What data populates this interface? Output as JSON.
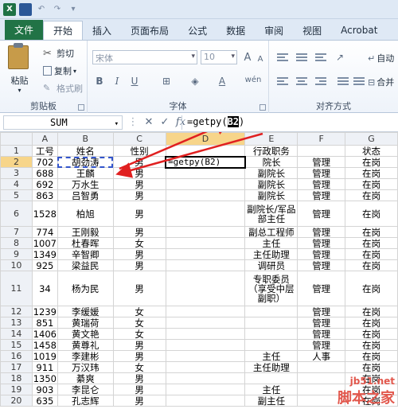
{
  "tabs": [
    "文件",
    "开始",
    "插入",
    "页面布局",
    "公式",
    "数据",
    "审阅",
    "视图",
    "Acrobat"
  ],
  "ribbon": {
    "clipboard": {
      "paste": "粘贴",
      "cut": "剪切",
      "copy": "复制",
      "format_painter": "格式刷",
      "label": "剪贴板"
    },
    "font": {
      "name": "宋体",
      "size": "10",
      "label": "字体",
      "bold": "B",
      "italic": "I",
      "underline": "U",
      "grow": "A",
      "shrink": "A",
      "wen": "wén"
    },
    "alignment": {
      "label": "对齐方式",
      "wrap": "自动",
      "merge": "合并"
    }
  },
  "formula_bar": {
    "name_box": "SUM",
    "cancel": "✕",
    "enter": "✓",
    "fx": "fx",
    "formula_prefix": "=getpy(",
    "formula_ref": "B2",
    "formula_suffix": ")"
  },
  "columns": [
    "A",
    "B",
    "C",
    "D",
    "E",
    "F",
    "G"
  ],
  "rows": [
    {
      "n": "1",
      "a": "工号",
      "b": "姓名",
      "c": "性别",
      "d": "",
      "e": "行政职务",
      "f": "",
      "g": "状态"
    },
    {
      "n": "2",
      "a": "702",
      "b": "胡劲涛",
      "c": "男",
      "d": "=getpy(B2)",
      "e": "院长",
      "f": "管理",
      "g": "在岗"
    },
    {
      "n": "3",
      "a": "688",
      "b": "王麟",
      "c": "男",
      "d": "",
      "e": "副院长",
      "f": "管理",
      "g": "在岗"
    },
    {
      "n": "4",
      "a": "692",
      "b": "万水生",
      "c": "男",
      "d": "",
      "e": "副院长",
      "f": "管理",
      "g": "在岗"
    },
    {
      "n": "5",
      "a": "863",
      "b": "吕智勇",
      "c": "男",
      "d": "",
      "e": "副院长",
      "f": "管理",
      "g": "在岗"
    },
    {
      "n": "6",
      "a": "1528",
      "b": "柏旭",
      "c": "男",
      "d": "",
      "e": "副院长/军品部主任",
      "f": "管理",
      "g": "在岗"
    },
    {
      "n": "7",
      "a": "774",
      "b": "王刚毅",
      "c": "男",
      "d": "",
      "e": "副总工程师",
      "f": "管理",
      "g": "在岗"
    },
    {
      "n": "8",
      "a": "1007",
      "b": "杜春晖",
      "c": "女",
      "d": "",
      "e": "主任",
      "f": "管理",
      "g": "在岗"
    },
    {
      "n": "9",
      "a": "1349",
      "b": "辛智卿",
      "c": "男",
      "d": "",
      "e": "主任助理",
      "f": "管理",
      "g": "在岗"
    },
    {
      "n": "10",
      "a": "925",
      "b": "梁益民",
      "c": "男",
      "d": "",
      "e": "调研员",
      "f": "管理",
      "g": "在岗"
    },
    {
      "n": "11",
      "a": "34",
      "b": "杨为民",
      "c": "男",
      "d": "",
      "e": "专职委员（享受中层副职）",
      "f": "管理",
      "g": "在岗"
    },
    {
      "n": "12",
      "a": "1239",
      "b": "李缓媛",
      "c": "女",
      "d": "",
      "e": "",
      "f": "管理",
      "g": "在岗"
    },
    {
      "n": "13",
      "a": "851",
      "b": "黄瑞荷",
      "c": "女",
      "d": "",
      "e": "",
      "f": "管理",
      "g": "在岗"
    },
    {
      "n": "14",
      "a": "1406",
      "b": "黄文艳",
      "c": "女",
      "d": "",
      "e": "",
      "f": "管理",
      "g": "在岗"
    },
    {
      "n": "15",
      "a": "1458",
      "b": "黄尊礼",
      "c": "男",
      "d": "",
      "e": "",
      "f": "管理",
      "g": "在岗"
    },
    {
      "n": "16",
      "a": "1019",
      "b": "李建彬",
      "c": "男",
      "d": "",
      "e": "主任",
      "f": "人事",
      "g": "在岗"
    },
    {
      "n": "17",
      "a": "911",
      "b": "万汉玮",
      "c": "女",
      "d": "",
      "e": "主任助理",
      "f": "",
      "g": "在岗"
    },
    {
      "n": "18",
      "a": "1350",
      "b": "綦爽",
      "c": "男",
      "d": "",
      "e": "",
      "f": "",
      "g": "在岗"
    },
    {
      "n": "19",
      "a": "903",
      "b": "李昆仑",
      "c": "男",
      "d": "",
      "e": "主任",
      "f": "",
      "g": "在岗"
    },
    {
      "n": "20",
      "a": "635",
      "b": "孔志辉",
      "c": "男",
      "d": "",
      "e": "副主任",
      "f": "",
      "g": "在岗"
    }
  ],
  "watermark": {
    "site": "jb51.net",
    "name": "脚本之家"
  },
  "colors": {
    "ribbon_bg": "#dfe9f5",
    "file_tab": "#217346",
    "arrow": "#e02020",
    "selection": "#f7d58a"
  }
}
